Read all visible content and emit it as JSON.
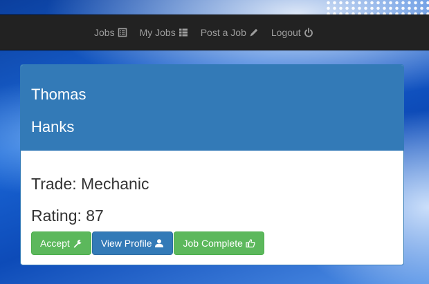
{
  "nav": {
    "items": [
      {
        "label": "Jobs",
        "icon": "list-alt-icon"
      },
      {
        "label": "My Jobs",
        "icon": "th-list-icon"
      },
      {
        "label": "Post a Job",
        "icon": "pencil-icon"
      },
      {
        "label": "Logout",
        "icon": "power-icon"
      }
    ]
  },
  "card": {
    "first_name": "Thomas",
    "last_name": "Hanks",
    "trade": "Trade: Mechanic",
    "rating": "Rating: 87"
  },
  "actions": {
    "accept_label": "Accept",
    "view_profile_label": "View Profile",
    "job_complete_label": "Job Complete"
  },
  "colors": {
    "navbar_bg": "#222222",
    "nav_text": "#9d9d9d",
    "primary": "#337ab7",
    "success": "#5cb85c"
  }
}
